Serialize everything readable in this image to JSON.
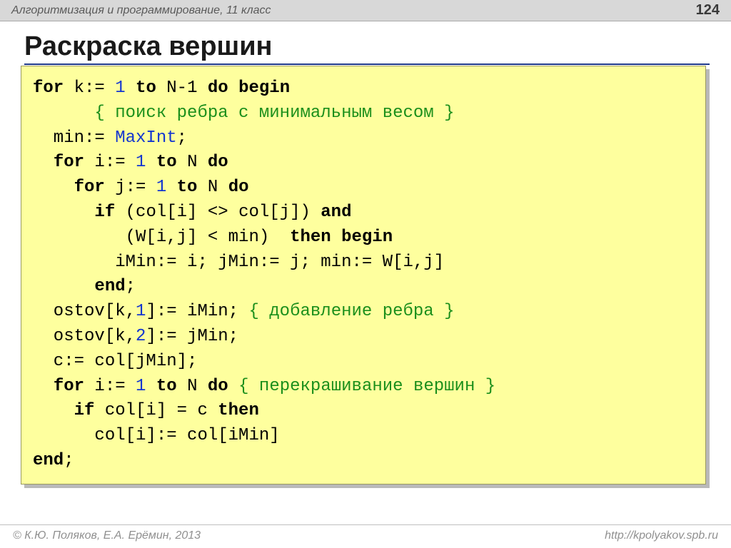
{
  "header": {
    "course": "Алгоритмизация и программирование, 11 класс",
    "page": "124"
  },
  "title": "Раскраска вершин",
  "code": {
    "l1": {
      "for": "for",
      "k": " k:= ",
      "one": "1",
      "to": " to",
      "nm1": " N-1 ",
      "do": "do",
      "begin": " begin"
    },
    "l2": {
      "cm": "{ поиск ребра с минимальным весом }"
    },
    "l3": {
      "a": "  min:= ",
      "maxint": "MaxInt",
      "b": ";"
    },
    "l4": {
      "for": "for",
      "i": " i:= ",
      "one": "1",
      "to": " to",
      "n": " N ",
      "do": "do"
    },
    "l5": {
      "for": "for",
      "j": " j:= ",
      "one": "1",
      "to": " to",
      "n": " N ",
      "do": "do"
    },
    "l6": {
      "if": "if",
      "cond": " (col[i] <> col[j]) ",
      "and": "and"
    },
    "l7": {
      "cond": "(W[i,j] < min) ",
      "then": " then",
      "begin": " begin"
    },
    "l8": {
      "body": "iMin:= i; jMin:= j; min:= W[i,j]"
    },
    "l9": {
      "end": "end",
      "semi": ";"
    },
    "l10": {
      "a": "  ostov[k,",
      "one": "1",
      "b": "]:= iMin; ",
      "cm": "{ добавление ребра }"
    },
    "l11": {
      "a": "  ostov[k,",
      "two": "2",
      "b": "]:= jMin;"
    },
    "l12": {
      "a": "  c:= col[jMin];"
    },
    "l13": {
      "for": "for",
      "i": " i:= ",
      "one": "1",
      "to": " to",
      "n": " N ",
      "do": "do",
      "sp": " ",
      "cm": "{ перекрашивание вершин }"
    },
    "l14": {
      "if": "if",
      "cond": " col[i] = c ",
      "then": "then"
    },
    "l15": {
      "body": "col[i]:= col[iMin]"
    },
    "l16": {
      "end": "end",
      "semi": ";"
    }
  },
  "footer": {
    "left": "© К.Ю. Поляков, Е.А. Ерёмин, 2013",
    "right": "http://kpolyakov.spb.ru"
  }
}
